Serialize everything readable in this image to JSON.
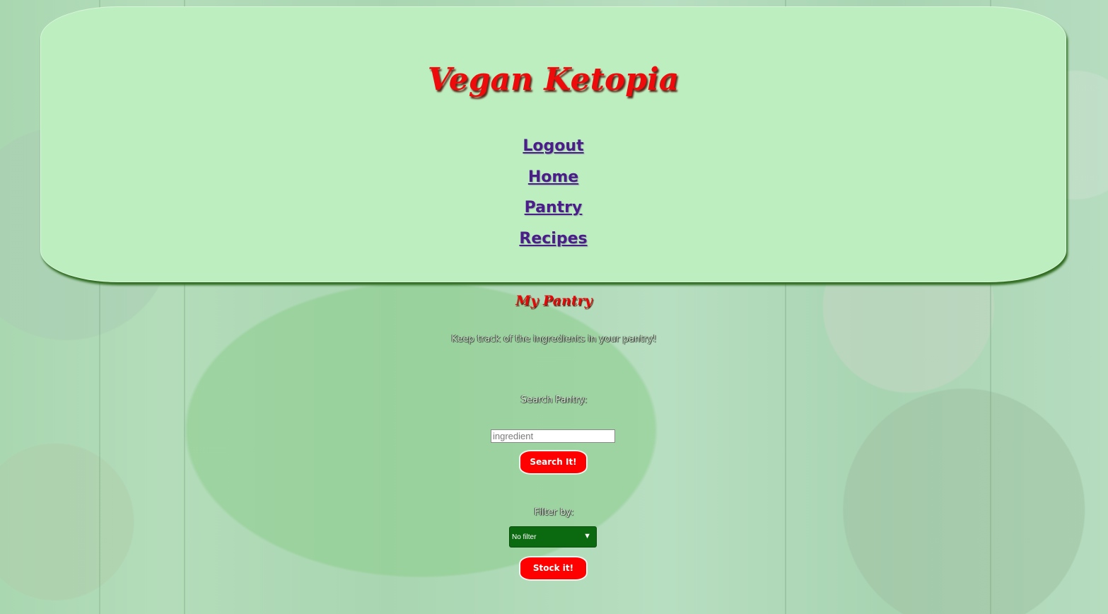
{
  "app": {
    "title": "Vegan Ketopia"
  },
  "nav": {
    "items": [
      {
        "label": "Logout"
      },
      {
        "label": "Home"
      },
      {
        "label": "Pantry"
      },
      {
        "label": "Recipes"
      }
    ]
  },
  "main": {
    "heading": "My Pantry",
    "subtitle": "Keep track of the ingredients in your pantry!",
    "search": {
      "label": "Search Pantry:",
      "placeholder": "ingredient",
      "button_label": "Search It!"
    },
    "filter": {
      "label": "Filter by:",
      "selected": "No filter",
      "caret_icon": "caret-down-icon"
    },
    "stock_button_label": "Stock it!"
  },
  "colors": {
    "header_bg": "#bdeec0",
    "title_red": "#ee0b0b",
    "nav_link": "#4b1d8a",
    "button_red": "#ff0000",
    "select_green": "#0b6a10"
  }
}
